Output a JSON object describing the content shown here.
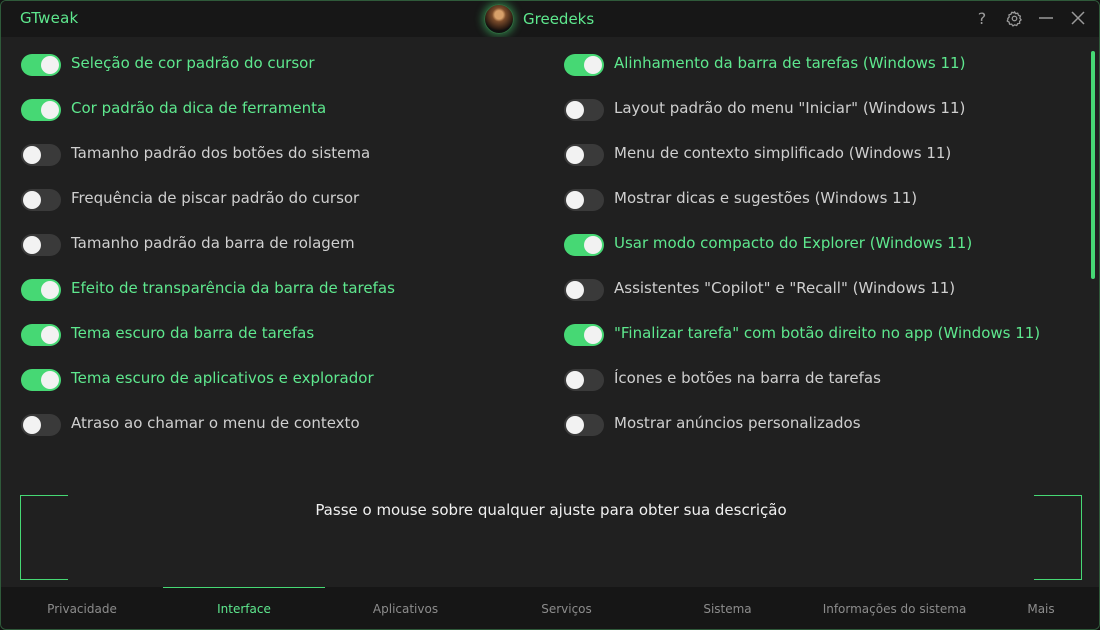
{
  "titlebar": {
    "app_title": "GTweak",
    "brand_name": "Greedeks",
    "controls": [
      "question-icon",
      "gear-icon",
      "minimize-icon",
      "close-icon"
    ]
  },
  "colors": {
    "accent": "#46d874",
    "accent_text": "#5ee88e",
    "background": "#202020",
    "off_track": "#3a3a3a"
  },
  "left_toggles": [
    {
      "label": "Seleção de cor padrão do cursor",
      "on": true
    },
    {
      "label": "Cor padrão da dica de ferramenta",
      "on": true
    },
    {
      "label": "Tamanho padrão dos botões do sistema",
      "on": false
    },
    {
      "label": "Frequência de piscar padrão do cursor",
      "on": false
    },
    {
      "label": "Tamanho padrão da barra de rolagem",
      "on": false
    },
    {
      "label": "Efeito de transparência da barra de tarefas",
      "on": true
    },
    {
      "label": "Tema escuro da barra de tarefas",
      "on": true
    },
    {
      "label": "Tema escuro de aplicativos e explorador",
      "on": true
    },
    {
      "label": "Atraso ao chamar o menu de contexto",
      "on": false
    }
  ],
  "right_toggles": [
    {
      "label": "Alinhamento da barra de tarefas (Windows 11)",
      "on": true
    },
    {
      "label": "Layout padrão do menu \"Iniciar\" (Windows 11)",
      "on": false
    },
    {
      "label": "Menu de contexto simplificado (Windows 11)",
      "on": false
    },
    {
      "label": "Mostrar dicas e sugestões (Windows 11)",
      "on": false
    },
    {
      "label": "Usar modo compacto do Explorer (Windows 11)",
      "on": true
    },
    {
      "label": "Assistentes \"Copilot\" e \"Recall\" (Windows 11)",
      "on": false
    },
    {
      "label": "\"Finalizar tarefa\" com botão direito no app (Windows 11)",
      "on": true
    },
    {
      "label": "Ícones e botões na barra de tarefas",
      "on": false
    },
    {
      "label": "Mostrar anúncios personalizados",
      "on": false
    }
  ],
  "description": {
    "text": "Passe o mouse sobre qualquer ajuste para obter sua descrição"
  },
  "nav": {
    "tabs": [
      {
        "label": "Privacidade",
        "active": false
      },
      {
        "label": "Interface",
        "active": true
      },
      {
        "label": "Aplicativos",
        "active": false
      },
      {
        "label": "Serviços",
        "active": false
      },
      {
        "label": "Sistema",
        "active": false
      },
      {
        "label": "Informações do sistema",
        "active": false
      },
      {
        "label": "Mais",
        "active": false
      }
    ]
  }
}
